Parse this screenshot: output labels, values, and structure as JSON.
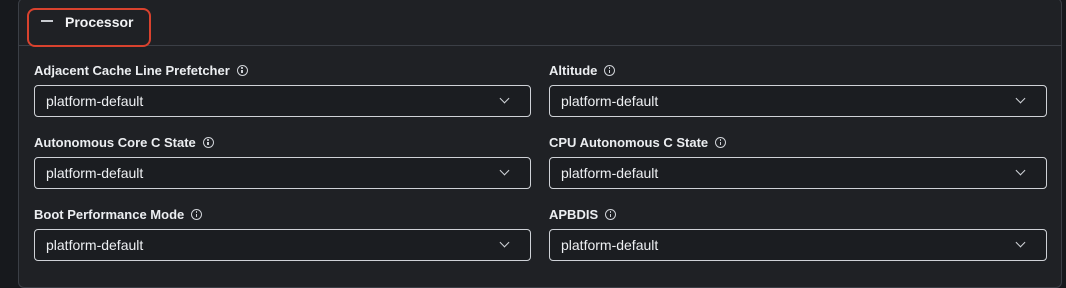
{
  "section": {
    "title": "Processor"
  },
  "fields": [
    {
      "label": "Adjacent Cache Line Prefetcher",
      "value": "platform-default"
    },
    {
      "label": "Altitude",
      "value": "platform-default"
    },
    {
      "label": "Autonomous Core C State",
      "value": "platform-default"
    },
    {
      "label": "CPU Autonomous C State",
      "value": "platform-default"
    },
    {
      "label": "Boot Performance Mode",
      "value": "platform-default"
    },
    {
      "label": "APBDIS",
      "value": "platform-default"
    }
  ],
  "icons": {
    "collapse": "minus-icon",
    "info": "info-icon",
    "dropdown": "chevron-down-icon"
  },
  "colors": {
    "highlight": "#d9422e"
  }
}
